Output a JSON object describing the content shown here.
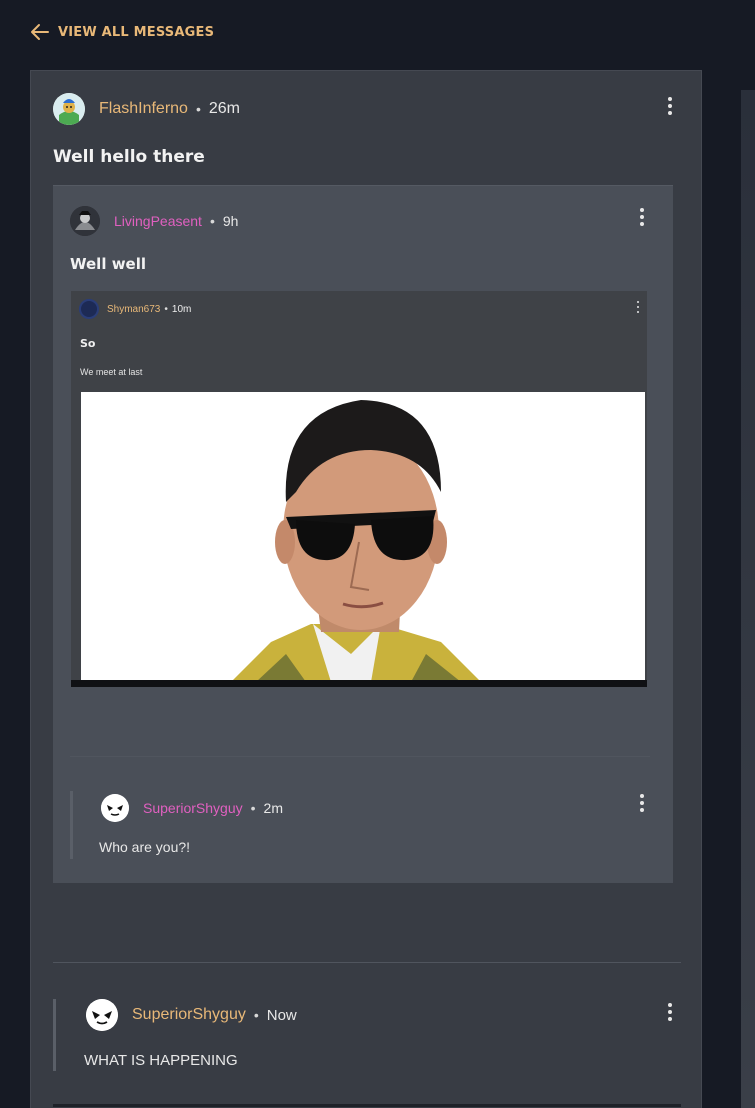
{
  "nav": {
    "back_label": "VIEW ALL MESSAGES"
  },
  "post": {
    "username": "FlashInferno",
    "time": "26m",
    "title": "Well hello there",
    "username_color": "#e8b878"
  },
  "quoted": {
    "username": "LivingPeasent",
    "time": "9h",
    "title": "Well well",
    "username_color": "#e060c0",
    "screenshot": {
      "username": "Shyman673",
      "time": "10m",
      "title": "So",
      "subtitle": "We meet at last"
    },
    "reply": {
      "username": "SuperiorShyguy",
      "time": "2m",
      "text": "Who are you?!"
    }
  },
  "reply": {
    "username": "SuperiorShyguy",
    "time": "Now",
    "text": "WHAT IS HAPPENING",
    "username_color": "#e8b878"
  },
  "separator": "•"
}
